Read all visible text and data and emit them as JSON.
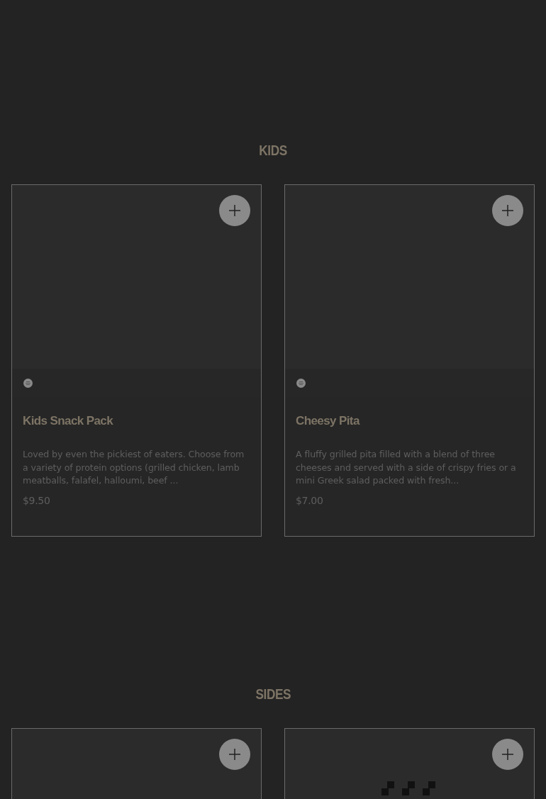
{
  "sections": [
    {
      "title": "KIDS",
      "items": [
        {
          "kind": "product",
          "name": "Kids Snack Pack",
          "description": "Loved by even the pickiest of eaters. Choose from a variety of protein options (grilled chicken, lamb meatballs, falafel, halloumi, beef ...",
          "price": "$9.50"
        },
        {
          "kind": "product",
          "name": "Cheesy Pita",
          "description": "A fluffy grilled pita filled with a blend of three cheeses and served with a side of crispy fries or a mini Greek salad packed with fresh...",
          "price": "$7.00"
        }
      ]
    },
    {
      "title": "SIDES",
      "items": [
        {
          "kind": "blank"
        },
        {
          "kind": "loading"
        }
      ]
    }
  ]
}
